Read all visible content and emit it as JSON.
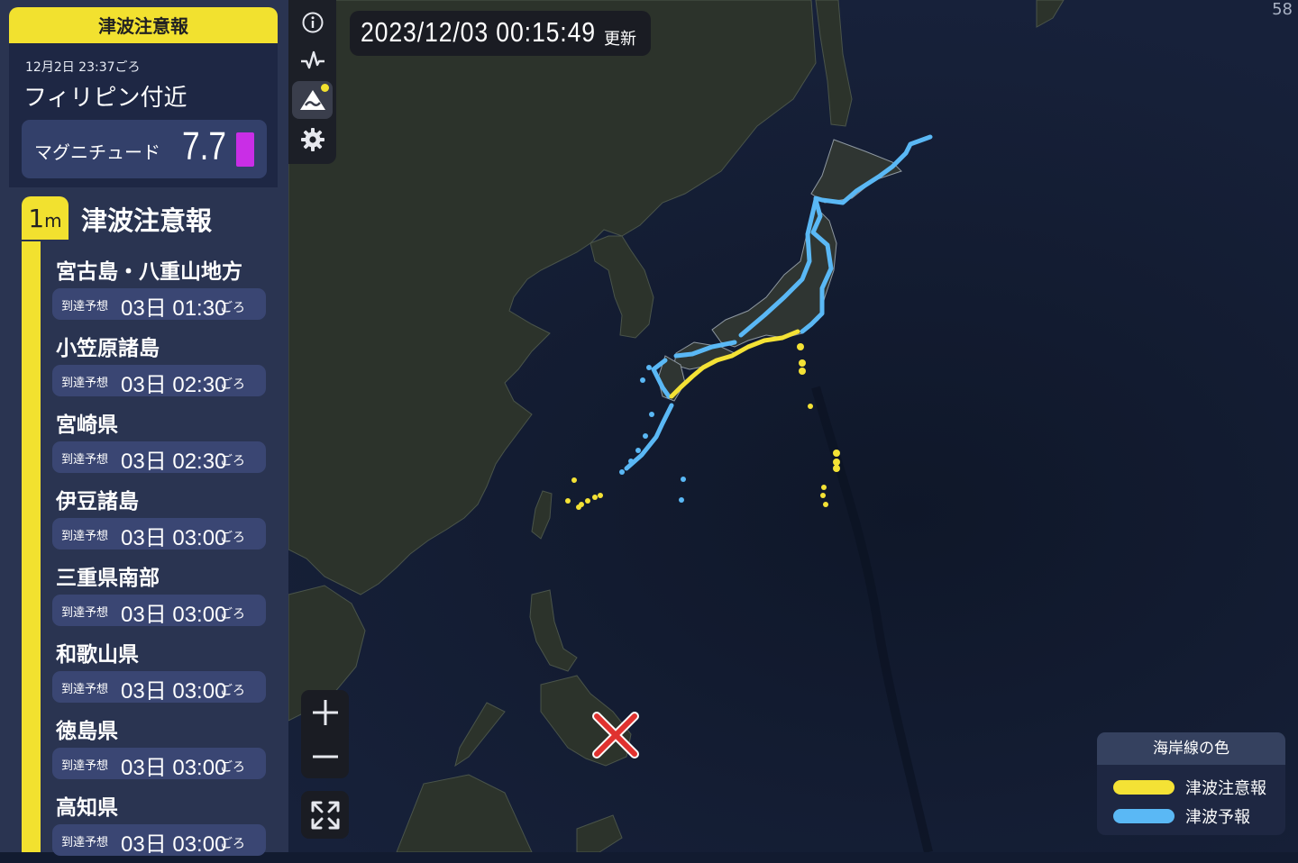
{
  "alert_header": "津波注意報",
  "earthquake": {
    "time": "12月2日 23:37ごろ",
    "place": "フィリピン付近",
    "magnitude_label": "マグニチュード",
    "magnitude_value": "7.7"
  },
  "level": {
    "badge_num": "1",
    "badge_unit": "m",
    "title": "津波注意報"
  },
  "arrival_label": "到達予想",
  "arrival_suffix": "ごろ",
  "areas": [
    {
      "name": "宮古島・八重山地方",
      "time": "03日 01:30"
    },
    {
      "name": "小笠原諸島",
      "time": "03日 02:30"
    },
    {
      "name": "宮崎県",
      "time": "03日 02:30"
    },
    {
      "name": "伊豆諸島",
      "time": "03日 03:00"
    },
    {
      "name": "三重県南部",
      "time": "03日 03:00"
    },
    {
      "name": "和歌山県",
      "time": "03日 03:00"
    },
    {
      "name": "徳島県",
      "time": "03日 03:00"
    },
    {
      "name": "高知県",
      "time": "03日 03:00"
    }
  ],
  "timestamp": {
    "value": "2023/12/03 00:15:49",
    "suffix": "更新"
  },
  "fps": "58",
  "legend": {
    "title": "海岸線の色",
    "items": [
      {
        "label": "津波注意報",
        "color": "#f4e235"
      },
      {
        "label": "津波予報",
        "color": "#5ab8f5"
      }
    ]
  },
  "toolbar": {
    "items": [
      "info-icon",
      "waveform-icon",
      "tsunami-icon",
      "gear-icon"
    ],
    "active": "tsunami-icon"
  },
  "colors": {
    "advisory": "#f4e235",
    "forecast": "#5ab8f5",
    "magnitude": "#c92ee6",
    "epicenter": "#e0322f",
    "ocean": "#131c33",
    "land": "#2c332b"
  }
}
